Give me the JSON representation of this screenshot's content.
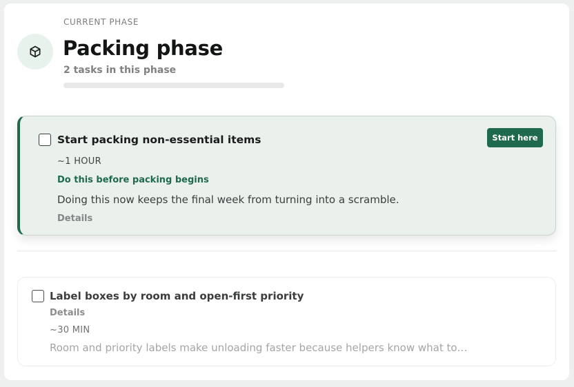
{
  "phase": {
    "eyebrow": "CURRENT PHASE",
    "title": "Packing phase",
    "task_count": "2 tasks in this phase",
    "progress": 0,
    "icon": "box-icon"
  },
  "tasks": [
    {
      "title": "Start packing non-essential items",
      "duration": "~1 HOUR",
      "hint": "Do this before packing begins",
      "description": "Doing this now keeps the final week from turning into a scramble.",
      "details_label": "Details",
      "action_label": "Start here",
      "checked": false,
      "active": true
    },
    {
      "title": "Label boxes by room and open-first priority",
      "details_label": "Details",
      "duration": "~30 MIN",
      "description": "Room and priority labels make unloading faster because helpers know what to o...",
      "checked": false,
      "active": false
    }
  ],
  "colors": {
    "accent": "#1f6a4d",
    "active_card_bg": "#eaf0ec",
    "icon_bg": "#e7f2ec"
  }
}
